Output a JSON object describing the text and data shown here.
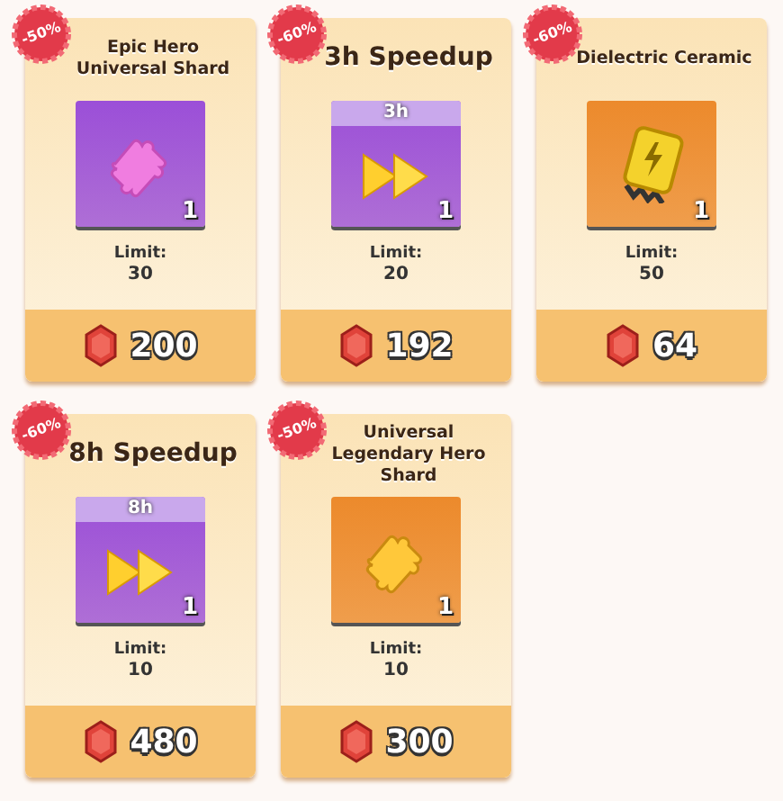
{
  "offers": [
    {
      "discount": "-50%",
      "title": "Epic Hero Universal Shard",
      "kind": "puzzle",
      "color": "#9b4fd8",
      "quantity": "1",
      "limit_label": "Limit:",
      "limit": "30",
      "price": "200"
    },
    {
      "discount": "-60%",
      "title": "3h Speedup",
      "kind": "speedup",
      "color": "#9b4fd8",
      "tile_label": "3h",
      "quantity": "1",
      "limit_label": "Limit:",
      "limit": "20",
      "price": "192"
    },
    {
      "discount": "-60%",
      "title": "Dielectric Ceramic",
      "kind": "ceramic",
      "color": "#ec8a2c",
      "quantity": "1",
      "limit_label": "Limit:",
      "limit": "50",
      "price": "64"
    },
    {
      "discount": "-60%",
      "title": "8h Speedup",
      "kind": "speedup",
      "color": "#9b4fd8",
      "tile_label": "8h",
      "quantity": "1",
      "limit_label": "Limit:",
      "limit": "10",
      "price": "480"
    },
    {
      "discount": "-50%",
      "title": "Universal Legendary Hero Shard",
      "kind": "gold-puzzle",
      "color": "#ec8a2c",
      "quantity": "1",
      "limit_label": "Limit:",
      "limit": "10",
      "price": "300"
    }
  ]
}
